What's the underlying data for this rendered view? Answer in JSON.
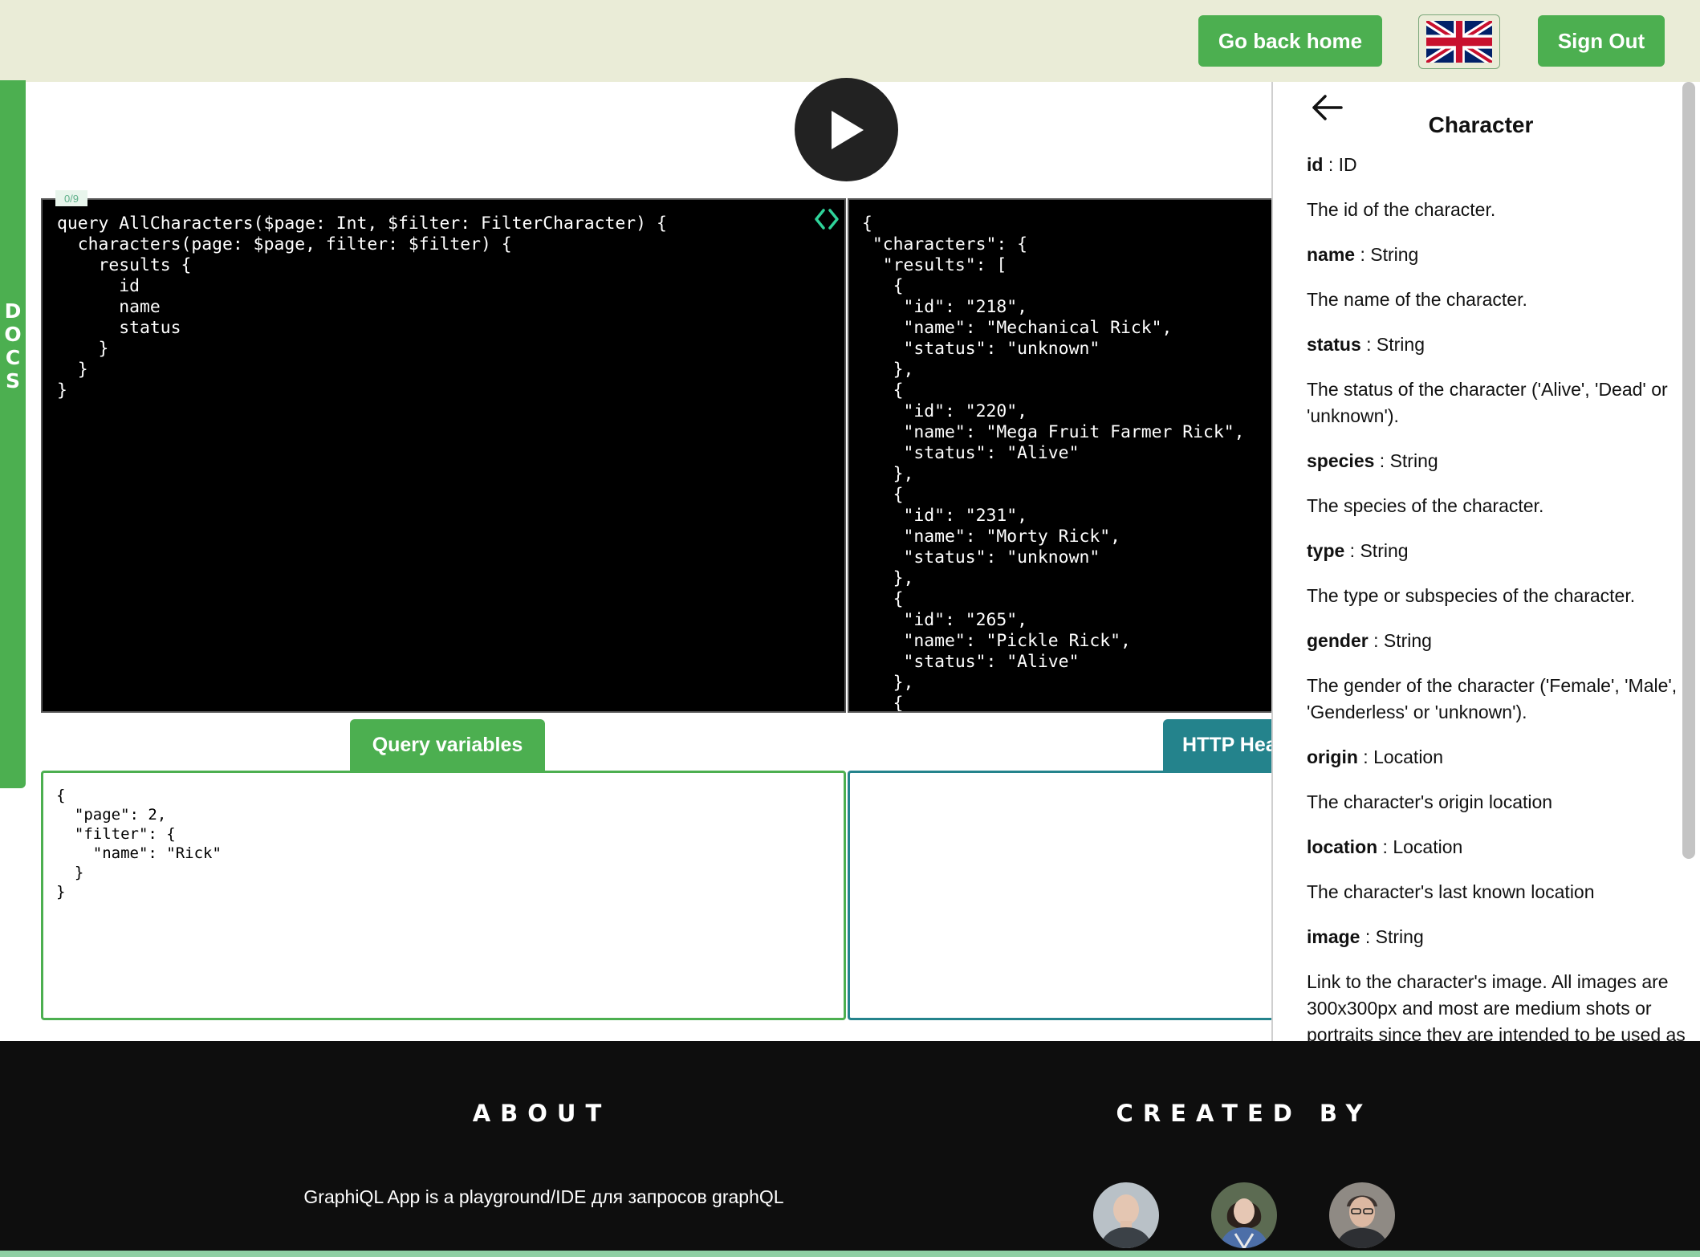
{
  "header": {
    "home_label": "Go back home",
    "signout_label": "Sign Out",
    "language_icon": "uk-flag-icon"
  },
  "sidebar": {
    "docs_letters": [
      "D",
      "O",
      "C",
      "S"
    ]
  },
  "editor": {
    "counter": "0/9",
    "query": "query AllCharacters($page: Int, $filter: FilterCharacter) {\n  characters(page: $page, filter: $filter) {\n    results {\n      id\n      name\n      status\n    }\n  }\n}"
  },
  "response": {
    "text": "{\n \"characters\": {\n  \"results\": [\n   {\n    \"id\": \"218\",\n    \"name\": \"Mechanical Rick\",\n    \"status\": \"unknown\"\n   },\n   {\n    \"id\": \"220\",\n    \"name\": \"Mega Fruit Farmer Rick\",\n    \"status\": \"Alive\"\n   },\n   {\n    \"id\": \"231\",\n    \"name\": \"Morty Rick\",\n    \"status\": \"unknown\"\n   },\n   {\n    \"id\": \"265\",\n    \"name\": \"Pickle Rick\",\n    \"status\": \"Alive\"\n   },\n   {"
  },
  "tabs": {
    "query_variables": "Query variables",
    "http_headers": "HTTP Headers"
  },
  "variables": {
    "text": "{\n  \"page\": 2,\n  \"filter\": {\n    \"name\": \"Rick\"\n  }\n}"
  },
  "docs": {
    "title": "Character",
    "fields": [
      {
        "name": "id",
        "type": "ID",
        "description": "The id of the character."
      },
      {
        "name": "name",
        "type": "String",
        "description": "The name of the character."
      },
      {
        "name": "status",
        "type": "String",
        "description": "The status of the character ('Alive', 'Dead' or 'unknown')."
      },
      {
        "name": "species",
        "type": "String",
        "description": "The species of the character."
      },
      {
        "name": "type",
        "type": "String",
        "description": "The type or subspecies of the character."
      },
      {
        "name": "gender",
        "type": "String",
        "description": "The gender of the character ('Female', 'Male', 'Genderless' or 'unknown')."
      },
      {
        "name": "origin",
        "type": "Location",
        "description": "The character's origin location"
      },
      {
        "name": "location",
        "type": "Location",
        "description": "The character's last known location"
      },
      {
        "name": "image",
        "type": "String",
        "description": "Link to the character's image. All images are 300x300px and most are medium shots or portraits since they are intended to be used as avatars."
      }
    ]
  },
  "footer": {
    "about_title": "ABOUT",
    "created_title": "CREATED BY",
    "about_text": "GraphiQL App is a playground/IDE для запросов graphQL"
  },
  "colors": {
    "header_bg": "#eaecd7",
    "accent_green": "#4caf50",
    "accent_teal": "#24838c",
    "footer_bg": "#0e0e0e"
  }
}
